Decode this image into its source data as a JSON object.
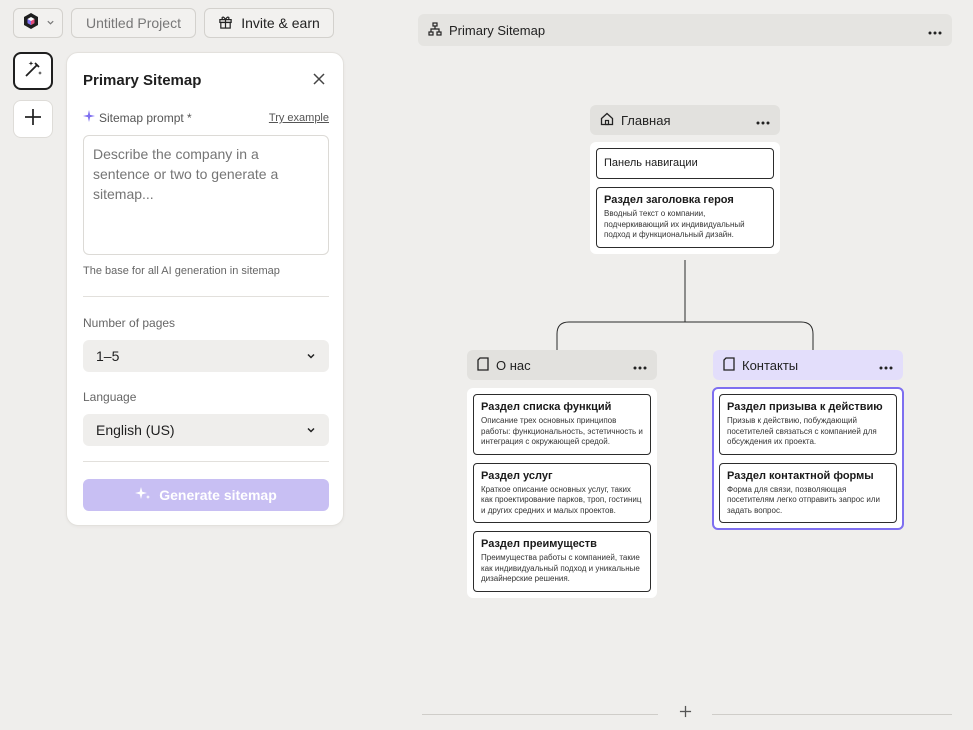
{
  "topbar": {
    "project_name": "Untitled Project",
    "invite_label": "Invite & earn"
  },
  "panel": {
    "title": "Primary Sitemap",
    "prompt_label": "Sitemap prompt *",
    "try_example": "Try example",
    "prompt_placeholder": "Describe the company in a sentence or two to generate a sitemap...",
    "prompt_help": "The base for all AI generation in sitemap",
    "pages_label": "Number of pages",
    "pages_value": "1–5",
    "language_label": "Language",
    "language_value": "English (US)",
    "generate_label": "Generate sitemap"
  },
  "canvas": {
    "sitemap_title": "Primary Sitemap",
    "home": {
      "title": "Главная",
      "sections": [
        {
          "title": "Панель навигации",
          "desc": ""
        },
        {
          "title": "Раздел заголовка героя",
          "desc": "Вводный текст о компании, подчеркивающий их индивидуальный подход и функциональный дизайн."
        }
      ]
    },
    "about": {
      "title": "О нас",
      "sections": [
        {
          "title": "Раздел списка функций",
          "desc": "Описание трех основных принципов работы: функциональность, эстетичность и интеграция с окружающей средой."
        },
        {
          "title": "Раздел услуг",
          "desc": "Краткое описание основных услуг, таких как проектирование парков, троп, гостиниц и других средних и малых проектов."
        },
        {
          "title": "Раздел преимуществ",
          "desc": "Преимущества работы с компанией, такие как индивидуальный подход и уникальные дизайнерские решения."
        }
      ]
    },
    "contacts": {
      "title": "Контакты",
      "sections": [
        {
          "title": "Раздел призыва к действию",
          "desc": "Призыв к действию, побуждающий посетителей связаться с компанией для обсуждения их проекта."
        },
        {
          "title": "Раздел контактной формы",
          "desc": "Форма для связи, позволяющая посетителям легко отправить запрос или задать вопрос."
        }
      ]
    }
  },
  "colors": {
    "accent": "#7e6ff0",
    "accent_light": "#e3defb",
    "generate_disabled": "#c8bff3",
    "background": "#efeeec"
  },
  "icons": [
    "logo-icon",
    "chevron-down-icon",
    "gift-icon",
    "magic-wand-icon",
    "plus-icon",
    "close-icon",
    "sparkle-icon",
    "sitemap-icon",
    "more-icon",
    "home-icon",
    "page-icon"
  ]
}
